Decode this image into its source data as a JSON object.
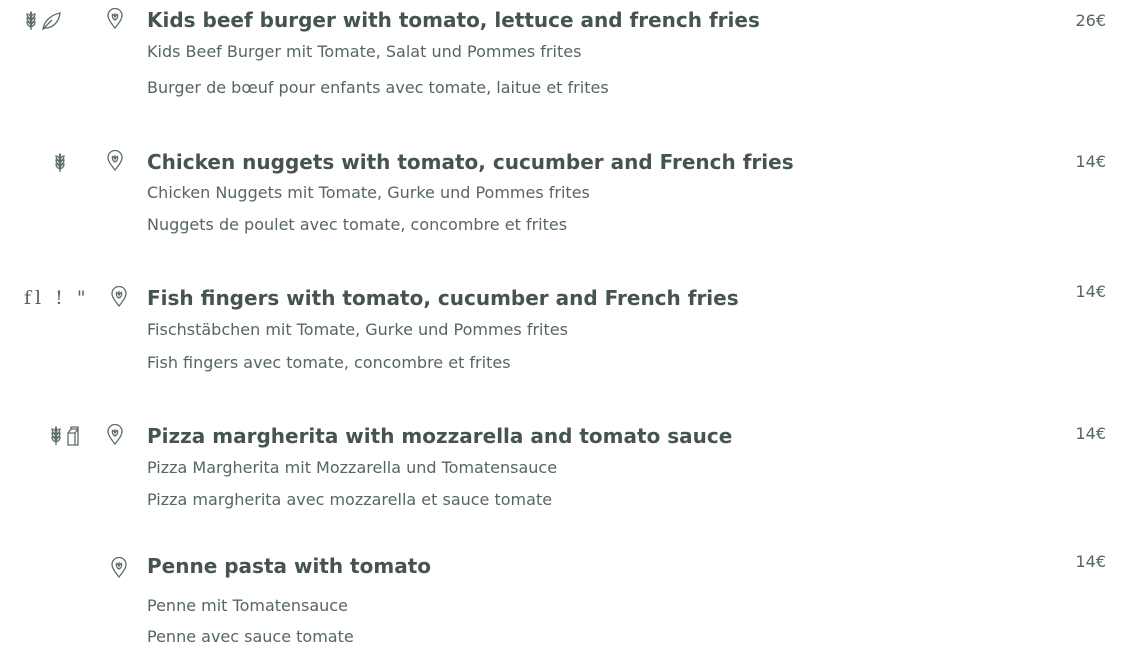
{
  "colors": {
    "text": "#45544f",
    "subtext": "#566662",
    "icons": "#5d6d69",
    "background": "#ffffff"
  },
  "menu": {
    "items": [
      {
        "title": "Kids beef burger with tomato, lettuce and french fries",
        "german": "Kids Beef Burger mit Tomate, Salat und Pommes frites",
        "french": "Burger de bœuf pour enfants avec tomate, laitue et frites",
        "price": "26€",
        "allergens": [
          "wheat-icon",
          "leaf-icon"
        ]
      },
      {
        "title": "Chicken nuggets with tomato, cucumber and French fries",
        "german": "Chicken Nuggets mit Tomate, Gurke und Pommes frites",
        "french": " Nuggets de poulet avec tomate, concombre et frites",
        "price": "14€",
        "allergens": [
          "wheat-icon"
        ]
      },
      {
        "title": "Fish fingers with tomato, cucumber and French fries",
        "german": "Fischstäbchen mit Tomate, Gurke und Pommes frites",
        "french": "Fish fingers avec tomate, concombre et frites",
        "price": "14€",
        "allergen_text": "fl ! \""
      },
      {
        "title": "Pizza margherita with mozzarella and tomato sauce",
        "german": "Pizza Margherita mit Mozzarella und Tomatensauce",
        "french": "Pizza margherita avec mozzarella et sauce tomate",
        "price": "14€",
        "allergens": [
          "wheat-icon",
          "milk-carton-icon"
        ]
      },
      {
        "title": "Penne pasta with tomato",
        "german": "Penne mit Tomatensauce",
        "french": "Penne avec sauce tomate",
        "price": "14€",
        "allergens": []
      }
    ]
  }
}
